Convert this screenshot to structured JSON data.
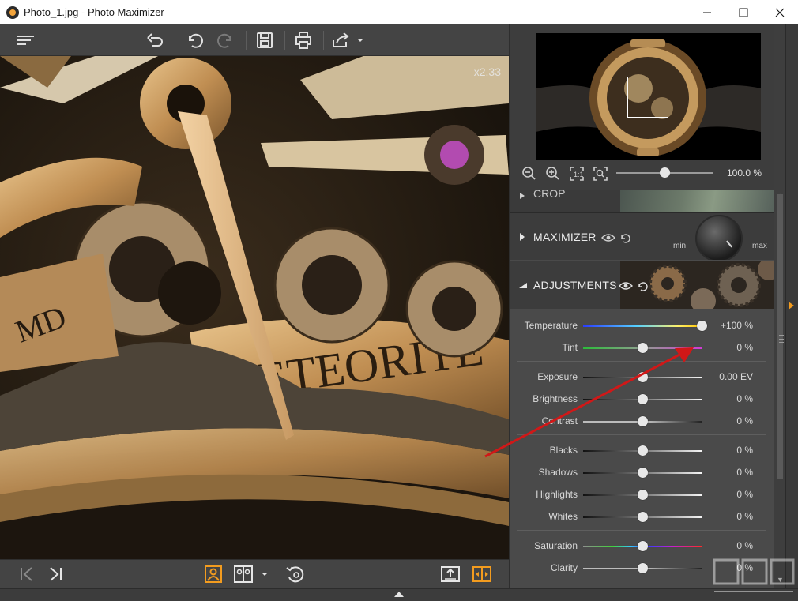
{
  "window": {
    "title": "Photo_1.jpg - Photo Maximizer",
    "minimize_icon": "minimize-icon",
    "maximize_icon": "maximize-icon",
    "close_icon": "close-icon"
  },
  "toolbar": {
    "icons": [
      "menu-icon",
      "undo-all-icon",
      "undo-icon",
      "redo-icon",
      "save-icon",
      "print-icon",
      "share-icon"
    ]
  },
  "viewport": {
    "zoom_factor": "x2.33"
  },
  "navigator": {
    "zoom_percent": "100.0 %",
    "zoom_level_fraction": 0.5,
    "icons": [
      "zoom-out-icon",
      "zoom-in-icon",
      "fit-icon",
      "actual-size-icon"
    ]
  },
  "sections": {
    "crop": {
      "label": "CROP"
    },
    "maximizer": {
      "label": "MAXIMIZER",
      "knob_min": "min",
      "knob_max": "max"
    },
    "adjustments": {
      "label": "ADJUSTMENTS"
    }
  },
  "adjustments": {
    "color": [
      {
        "label": "Temperature",
        "value": "+100 %",
        "level": 1.0,
        "track": "temperature"
      },
      {
        "label": "Tint",
        "value": "0 %",
        "level": 0.5,
        "track": "tint"
      }
    ],
    "tone": [
      {
        "label": "Exposure",
        "value": "0.00 EV",
        "level": 0.5,
        "track": "dark-light"
      },
      {
        "label": "Brightness",
        "value": "0 %",
        "level": 0.5,
        "track": "dark-light"
      },
      {
        "label": "Contrast",
        "value": "0 %",
        "level": 0.5,
        "track": "contrast"
      }
    ],
    "detail": [
      {
        "label": "Blacks",
        "value": "0 %",
        "level": 0.5,
        "track": "dark-light"
      },
      {
        "label": "Shadows",
        "value": "0 %",
        "level": 0.5,
        "track": "dark-light"
      },
      {
        "label": "Highlights",
        "value": "0 %",
        "level": 0.5,
        "track": "dark-light"
      },
      {
        "label": "Whites",
        "value": "0 %",
        "level": 0.5,
        "track": "dark-light"
      }
    ],
    "presence": [
      {
        "label": "Saturation",
        "value": "0 %",
        "level": 0.5,
        "track": "saturation"
      },
      {
        "label": "Clarity",
        "value": "0 %",
        "level": 0.5,
        "track": "contrast"
      }
    ]
  },
  "bottombar": {
    "icons": [
      "first-image-icon",
      "next-image-icon",
      "single-view-icon",
      "compare-view-icon",
      "view-dropdown-icon",
      "rotate-icon",
      "export-icon",
      "split-view-icon"
    ]
  },
  "colors": {
    "accent": "#f39c1f",
    "annotation_arrow": "#d01818",
    "panel_bg": "#4a4a4a",
    "toolbar_bg": "#444444"
  }
}
